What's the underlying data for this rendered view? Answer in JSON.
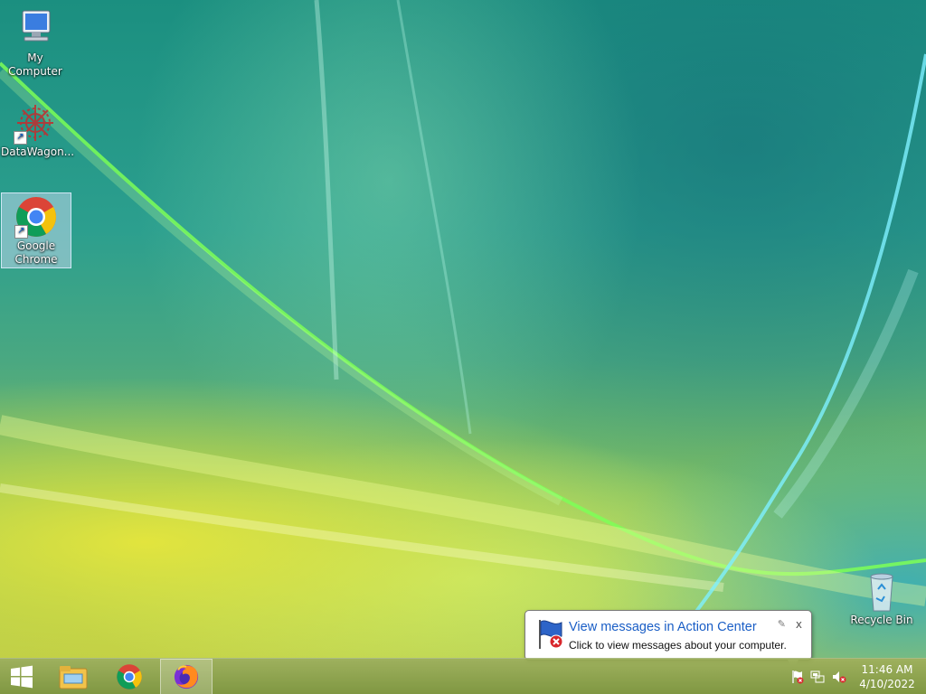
{
  "desktop_icons": [
    {
      "label": "My Computer"
    },
    {
      "label": "DataWagon..."
    },
    {
      "label": "Google Chrome"
    },
    {
      "label": "Recycle Bin"
    }
  ],
  "taskbar": {
    "start": "start-icon",
    "pinned": [
      "file-explorer-icon",
      "chrome-icon",
      "firefox-icon"
    ],
    "active_app": "firefox-icon"
  },
  "tray": {
    "icons": [
      "action-center-flag-icon",
      "network-icon",
      "volume-muted-icon"
    ],
    "time": "11:46 AM",
    "date": "4/10/2022"
  },
  "notification": {
    "title": "View messages in Action Center",
    "message": "Click to view messages about your computer.",
    "close_label": "x"
  },
  "colors": {
    "balloon_title": "#1a5ec6",
    "taskbar": "#8fa450"
  }
}
